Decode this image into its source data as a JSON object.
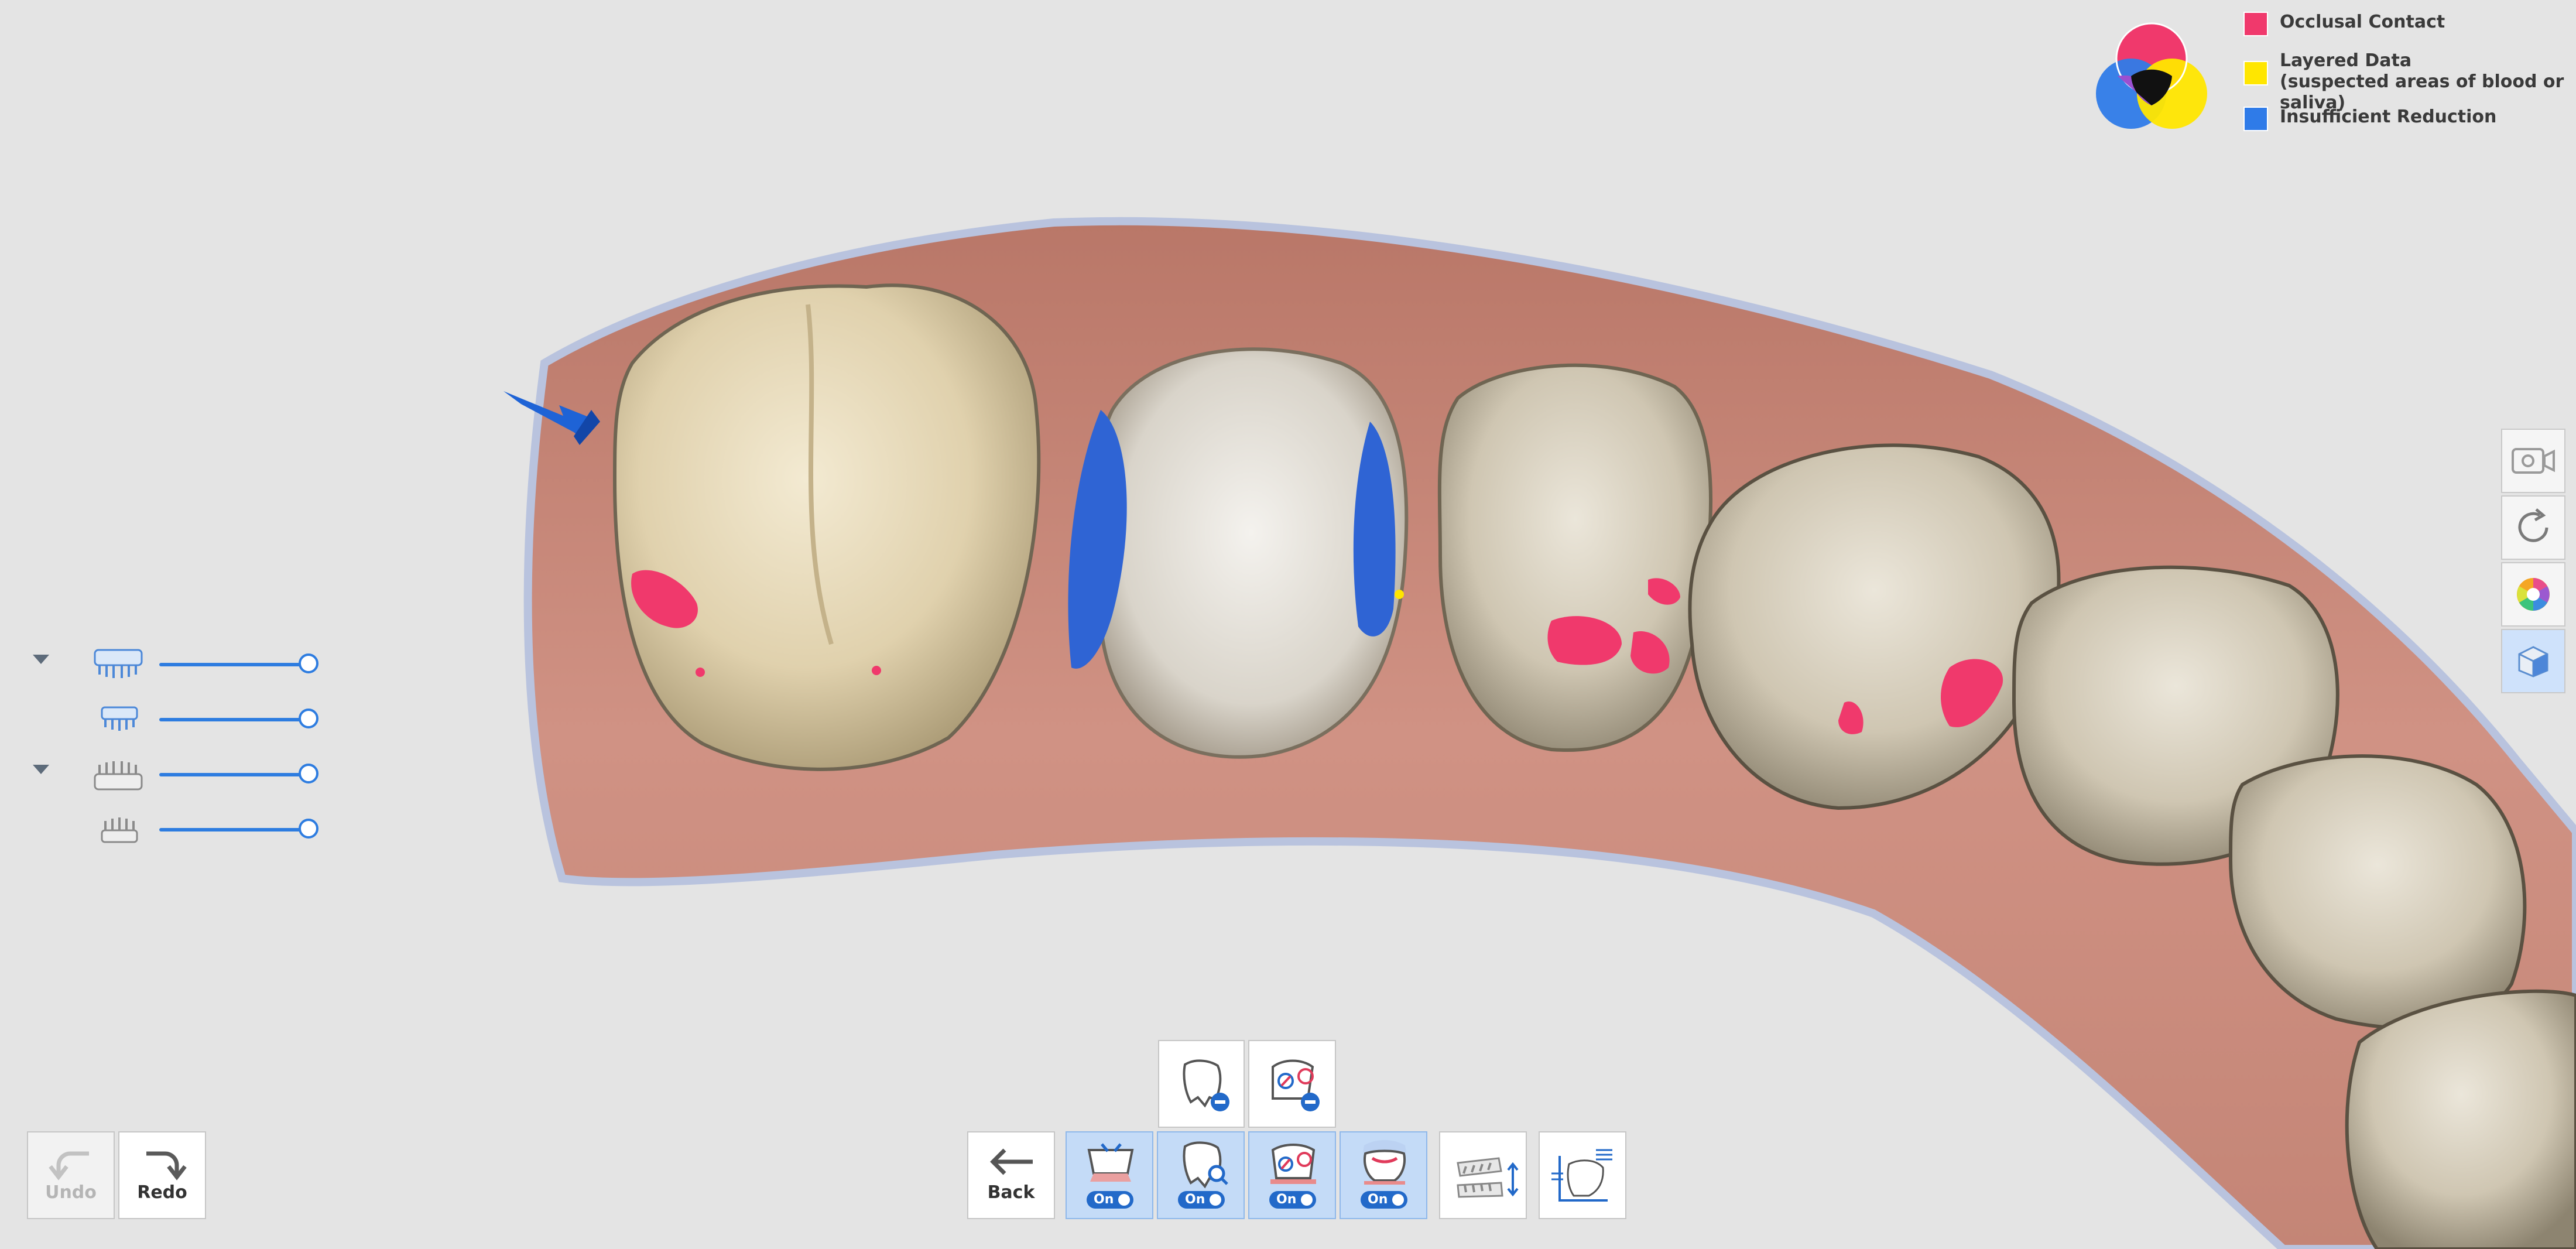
{
  "legend": {
    "items": [
      {
        "label": "Occlusal Contact",
        "color": "#f0396c"
      },
      {
        "label": "Layered Data\n(suspected areas of blood or saliva)",
        "color": "#ffe600"
      },
      {
        "label": "Insufficient Reduction",
        "color": "#2f7be8"
      }
    ]
  },
  "toolbar": {
    "undo_label": "Undo",
    "redo_label": "Redo",
    "back_label": "Back",
    "on_label": "On"
  },
  "icons": {
    "undo": "undo-arrow-icon",
    "redo": "redo-arrow-icon",
    "back": "left-arrow-icon",
    "screen_record": "video-camera-icon",
    "reset_view": "rotate-icon",
    "color": "color-wheel-icon",
    "texture": "cube-icon"
  },
  "colors": {
    "accent": "#2d7ce0",
    "active_button": "#c4dbf7",
    "occlusal": "#f0396c",
    "reduction": "#2f7be8",
    "gum": "#c9857a"
  },
  "layers": [
    {
      "id": "upper-jaw",
      "expandable": true,
      "level": 1.0
    },
    {
      "id": "upper-prep",
      "expandable": false,
      "level": 1.0
    },
    {
      "id": "lower-jaw",
      "expandable": true,
      "level": 1.0
    },
    {
      "id": "lower-prep",
      "expandable": false,
      "level": 1.0
    }
  ]
}
